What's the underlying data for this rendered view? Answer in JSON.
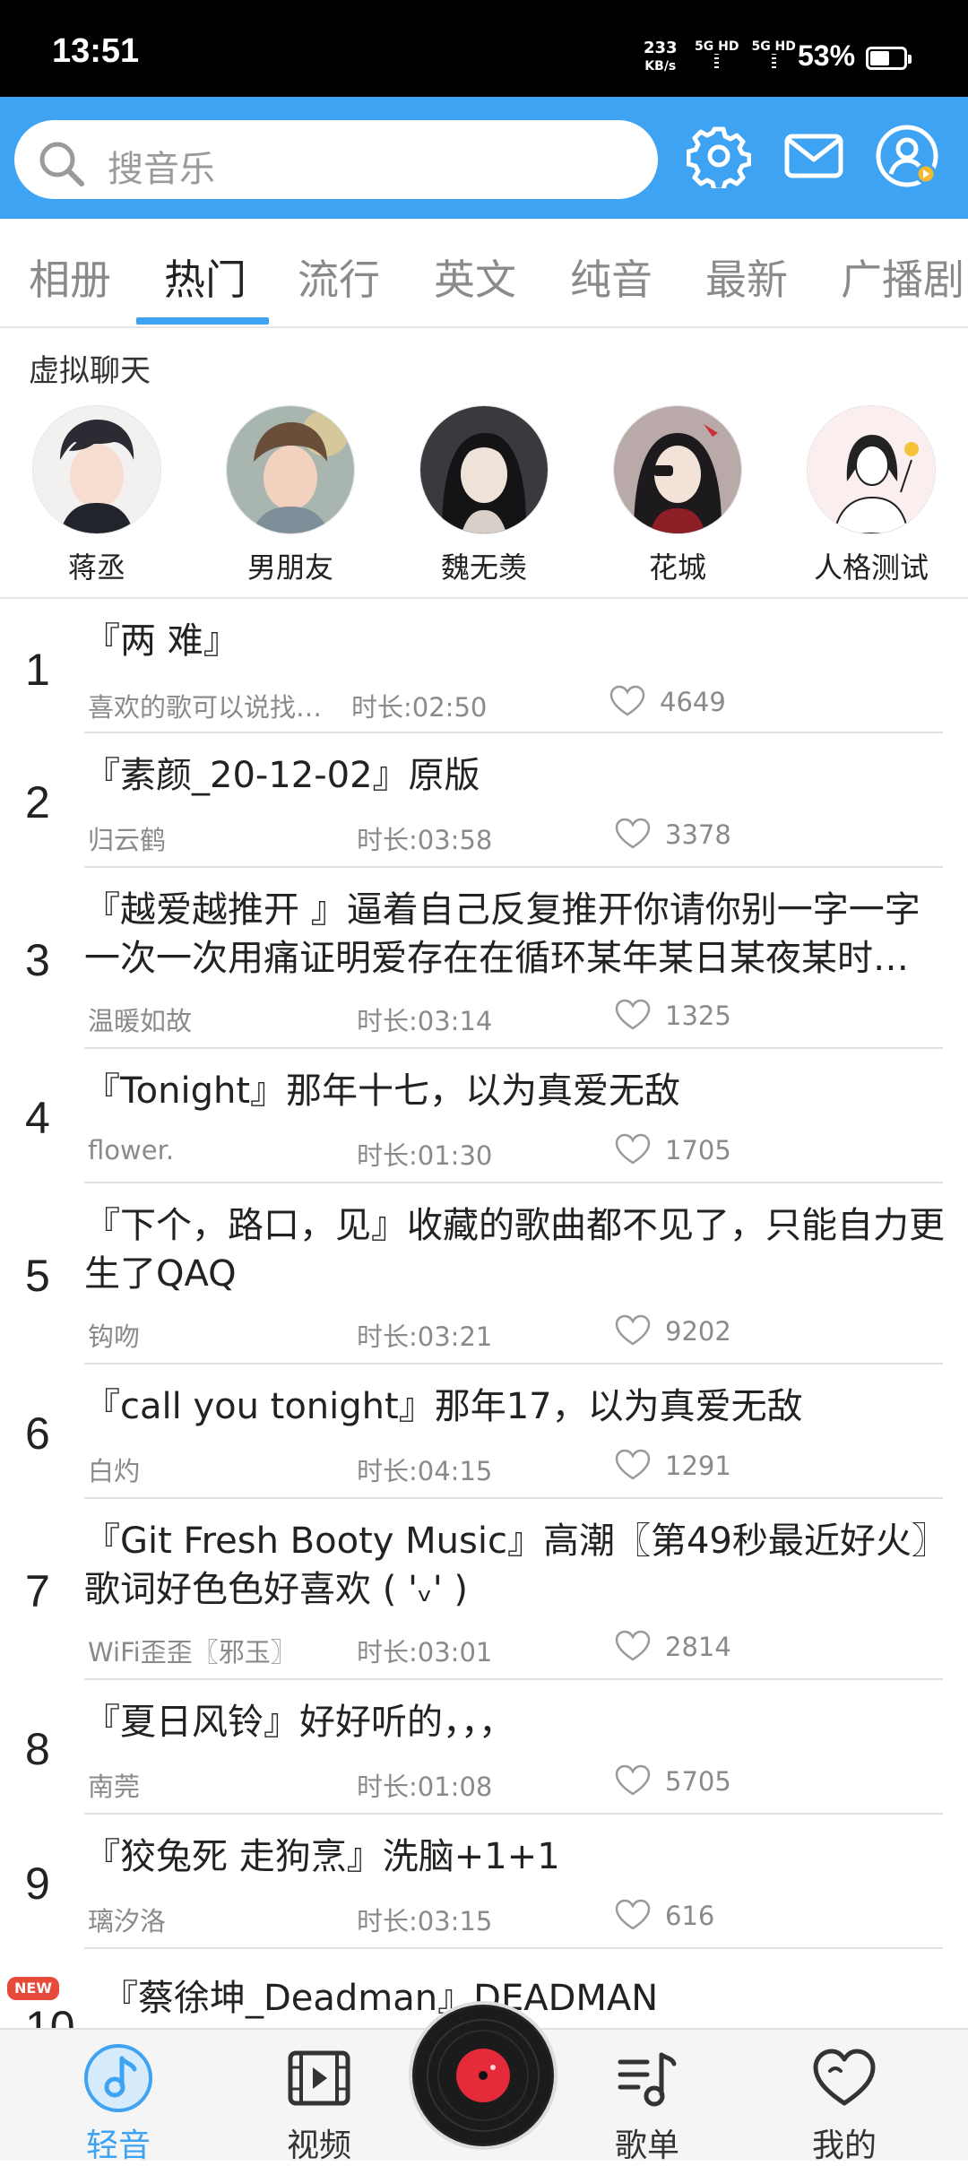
{
  "status": {
    "time": "13:51",
    "net_speed": "233",
    "net_unit": "KB/s",
    "sim1": "5G HD",
    "sim2": "5G HD",
    "battery": "53%",
    "battery_level": 0.53
  },
  "search": {
    "placeholder": "搜音乐"
  },
  "tabs": [
    "相册",
    "热门",
    "流行",
    "英文",
    "纯音",
    "最新",
    "广播剧"
  ],
  "active_tab": "热门",
  "virtual_chat": {
    "title": "虚拟聊天",
    "avatars": [
      "蒋丞",
      "男朋友",
      "魏无羡",
      "花城",
      "人格测试"
    ]
  },
  "songs": [
    {
      "rank": "1",
      "title": "『两 难』",
      "author": "喜欢的歌可以说找…",
      "duration": "时长:02:50",
      "likes": "4649"
    },
    {
      "rank": "2",
      "title": "『素颜_20-12-02』原版",
      "author": "归云鹤",
      "duration": "时长:03:58",
      "likes": "3378"
    },
    {
      "rank": "3",
      "title": "『越爱越推开 』逼着自己反复推开你请你别一字一字",
      "title2": "一次一次用痛证明爱存在在循环某年某日某夜某时…",
      "author": "温暖如故",
      "duration": "时长:03:14",
      "likes": "1325"
    },
    {
      "rank": "4",
      "title": "『Tonight』那年十七，以为真爱无敌",
      "author": "flower.",
      "duration": "时长:01:30",
      "likes": "1705"
    },
    {
      "rank": "5",
      "title": "『下个，路口，见』收藏的歌曲都不见了，只能自力更",
      "title2": "生了QAQ",
      "author": "钩吻",
      "duration": "时长:03:21",
      "likes": "9202"
    },
    {
      "rank": "6",
      "title": "『call you tonight』那年17，以为真爱无敌",
      "author": "白灼",
      "duration": "时长:04:15",
      "likes": "1291"
    },
    {
      "rank": "7",
      "title": "『Git Fresh Booty Music』高潮〖第49秒最近好火〗",
      "title2": "歌词好色色好喜欢 ( 'ᵥ' )",
      "author": "WiFi歪歪〖邪玉〗",
      "duration": "时长:03:01",
      "likes": "2814"
    },
    {
      "rank": "8",
      "title": "『夏日风铃』好好听的，，，",
      "author": "南莞",
      "duration": "时长:01:08",
      "likes": "5705"
    },
    {
      "rank": "9",
      "title": "『狡兔死 走狗烹』洗脑+1+1",
      "author": "璃汐洛",
      "duration": "时长:03:15",
      "likes": "616"
    },
    {
      "rank": "10",
      "title": "『蔡徐坤_Deadman』DEADMAN",
      "badge": "NEW"
    }
  ],
  "bottom_nav": [
    "轻音",
    "视频",
    "歌单",
    "我的"
  ],
  "colors": {
    "accent": "#3ea3f2",
    "badge": "#e64a3a",
    "disc_center": "#e52a3a"
  }
}
